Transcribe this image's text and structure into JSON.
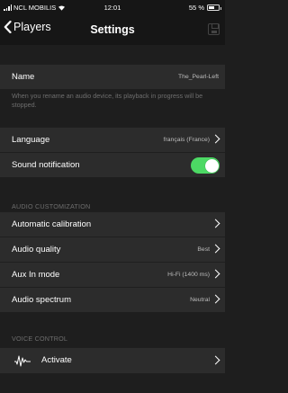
{
  "status_bar": {
    "carrier": "NCL MOBILIS",
    "time": "12:01",
    "battery": "55 %",
    "battery_level": 0.55
  },
  "nav": {
    "back_label": "Players",
    "title": "Settings",
    "save_icon": "save-icon"
  },
  "device": {
    "name_label": "Name",
    "name_value": "The_Pearl-Left",
    "rename_note": "When you rename an audio device, its playback in progress will be stopped."
  },
  "language": {
    "label": "Language",
    "value": "français (France)"
  },
  "sound_notification": {
    "label": "Sound notification",
    "enabled": true,
    "color": "#4cd964"
  },
  "audio_customization": {
    "header": "AUDIO CUSTOMIZATION",
    "items": [
      {
        "label": "Automatic calibration",
        "value": ""
      },
      {
        "label": "Audio quality",
        "value": "Best"
      },
      {
        "label": "Aux In mode",
        "value": "Hi-Fi (1400 ms)"
      },
      {
        "label": "Audio spectrum",
        "value": "Neutral"
      }
    ]
  },
  "voice_control": {
    "header": "VOICE CONTROL",
    "activate_label": "Activate",
    "icon": "voice-wave-icon"
  }
}
